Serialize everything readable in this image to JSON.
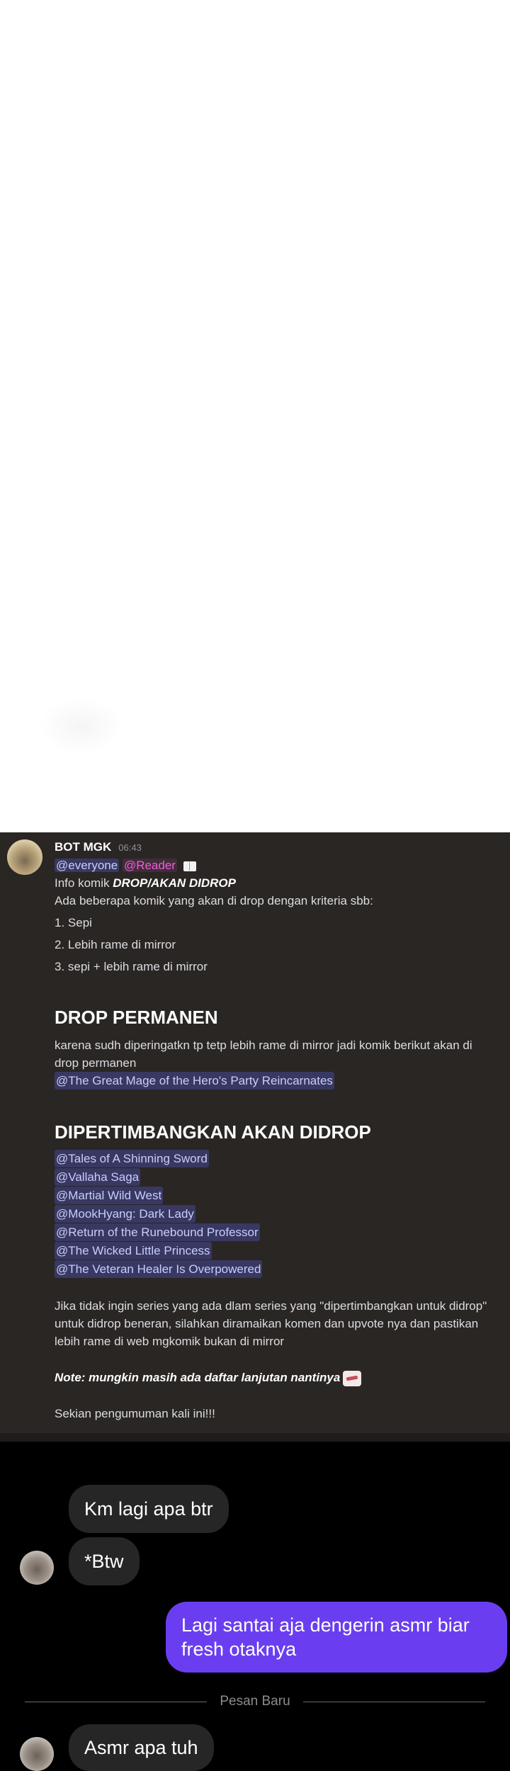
{
  "discord": {
    "author": "BOT MGK",
    "time": "06:43",
    "mention_everyone": "@everyone",
    "mention_reader": "@Reader",
    "info_prefix": "Info komik ",
    "info_bold": "DROP/AKAN DIDROP",
    "intro": "Ada beberapa komik yang akan di drop dengan kriteria sbb:",
    "criteria": [
      "1. Sepi",
      "2. Lebih rame di mirror",
      "3. sepi + lebih rame di mirror"
    ],
    "section1_title": "DROP PERMANEN",
    "section1_text": "karena sudh diperingatkn tp tetp lebih rame di mirror jadi komik berikut akan di drop permanen",
    "section1_mentions": [
      "@The Great Mage of the Hero's Party Reincarnates"
    ],
    "section2_title": "DIPERTIMBANGKAN AKAN DIDROP",
    "section2_mentions": [
      "@Tales of A Shinning Sword",
      "@Vallaha Saga",
      "@Martial Wild West",
      "@MookHyang: Dark Lady",
      "@Return of the Runebound Professor",
      "@The Wicked Little Princess",
      "@The Veteran Healer Is Overpowered"
    ],
    "closing_text": "Jika tidak ingin series yang ada dlam series yang \"dipertimbangkan untuk didrop\" untuk didrop beneran, silahkan diramaikan komen dan upvote nya dan pastikan lebih rame di web mgkomik bukan di mirror",
    "note": "Note: mungkin masih ada daftar lanjutan nantinya",
    "signoff": "Sekian pengumuman kali ini!!!",
    "icons": {
      "book": "book-icon",
      "sticker": "sticker-icon"
    }
  },
  "chat": {
    "msg1": "Km lagi apa btr",
    "msg2": "*Btw",
    "msg_out": "Lagi santai aja dengerin asmr biar fresh otaknya",
    "divider": "Pesan Baru",
    "msg3": "Asmr apa tuh",
    "colors": {
      "incoming": "#262626",
      "outgoing": "#6a3ef0"
    }
  }
}
